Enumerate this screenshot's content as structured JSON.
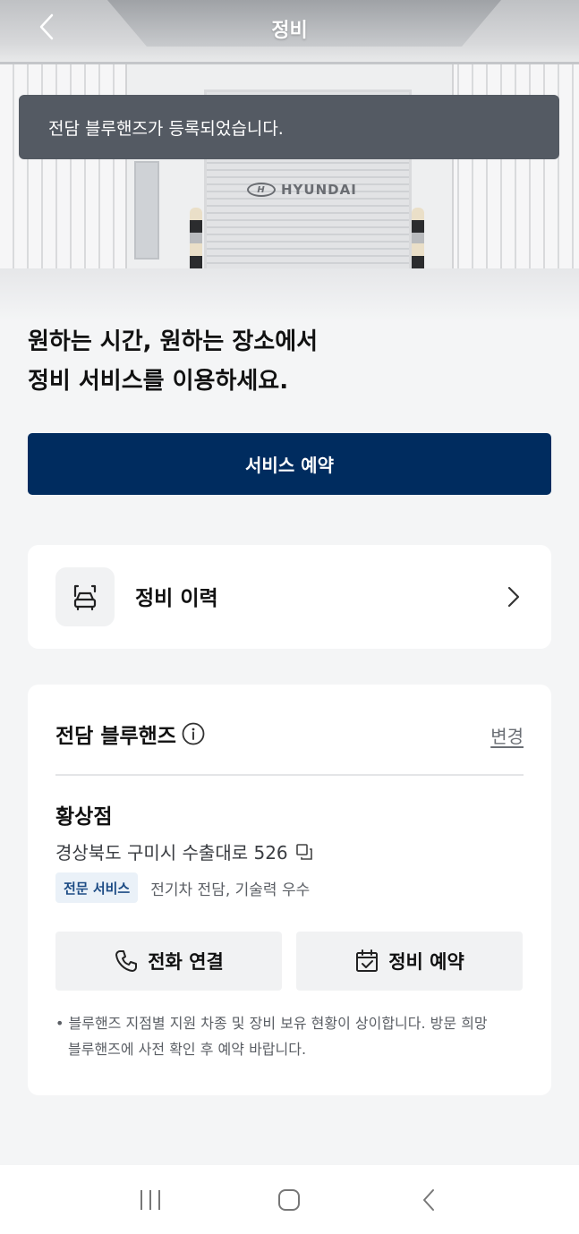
{
  "header": {
    "title": "정비",
    "back_icon": "chevron-left-icon"
  },
  "hero": {
    "brand_text": "HYUNDAI"
  },
  "toast": {
    "message": "전담 블루핸즈가 등록되었습니다."
  },
  "headline": {
    "line1": "원하는 시간, 원하는 장소에서",
    "line2": "정비 서비스를 이용하세요."
  },
  "cta": {
    "label": "서비스 예약"
  },
  "history": {
    "label": "정비 이력",
    "icon": "car-repair-icon",
    "chevron": "chevron-right-icon"
  },
  "bluehands": {
    "title": "전담 블루핸즈",
    "info_icon": "info-icon",
    "change_label": "변경",
    "branch_name": "황상점",
    "address": "경상북도 구미시 수출대로 526",
    "copy_icon": "copy-icon",
    "tag": "전문 서비스",
    "tag_description": "전기차 전담, 기술력 우수",
    "call_button": "전화 연결",
    "reserve_button": "정비 예약",
    "notice": "• 블루핸즈 지점별 지원 차종 및 장비 보유 현황이 상이합니다. 방문 희망 블루핸즈에 사전 확인 후 예약 바랍니다."
  },
  "colors": {
    "primary": "#002c5f",
    "toast_bg": "#545a63",
    "tag_bg": "#eaf1f8",
    "tag_text": "#1c4b84",
    "page_bg": "#f4f5f6"
  },
  "system_nav": {
    "recents_icon": "recents-icon",
    "home_icon": "home-icon",
    "back_icon": "back-icon"
  }
}
